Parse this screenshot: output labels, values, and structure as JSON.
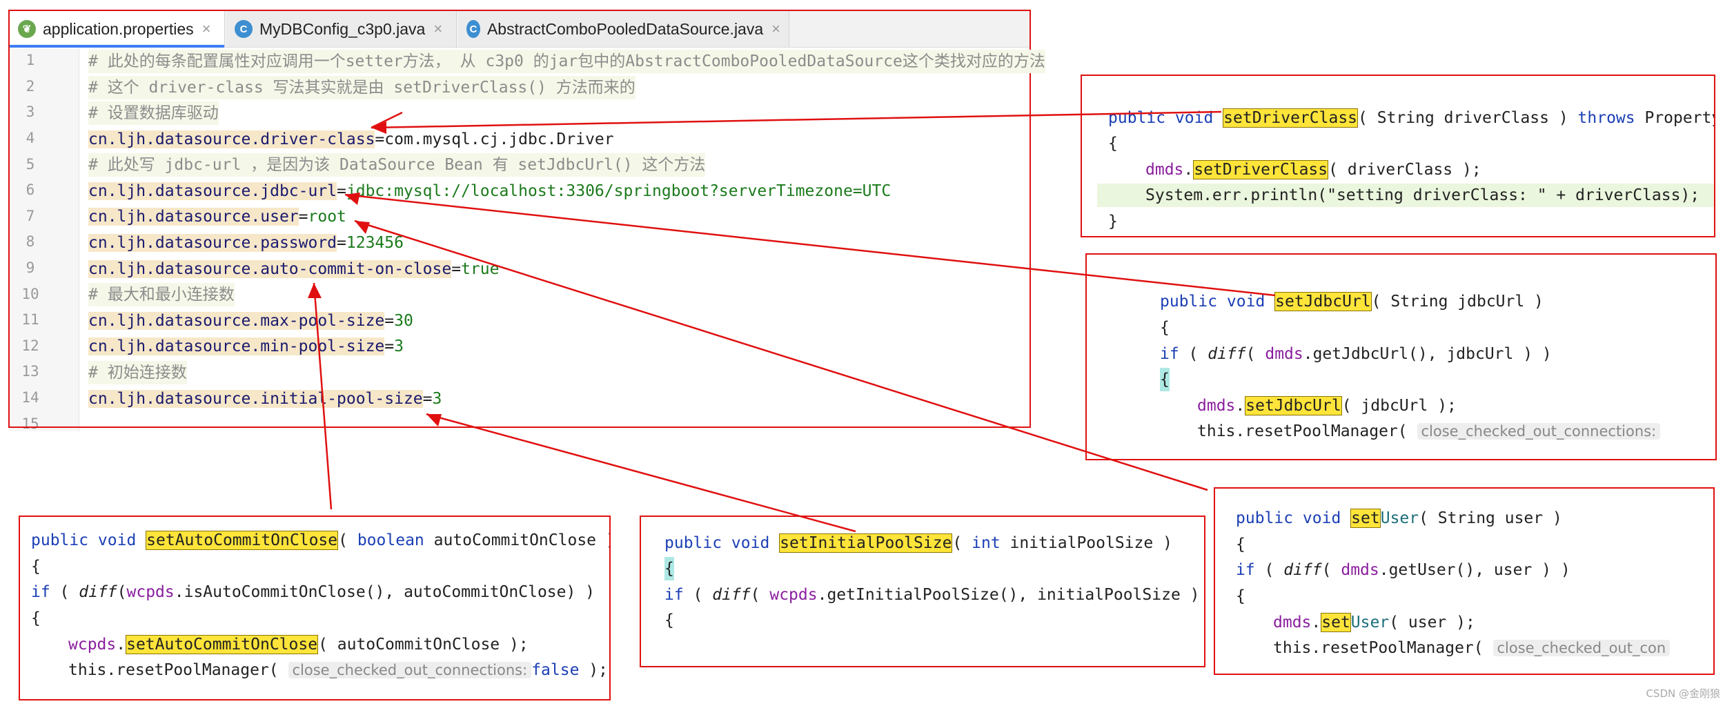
{
  "tabs": [
    {
      "label": "application.properties",
      "icon": "leaf-file-icon",
      "active": true
    },
    {
      "label": "MyDBConfig_c3p0.java",
      "icon": "class-file-icon",
      "active": false
    },
    {
      "label": "AbstractComboPooledDataSource.java",
      "icon": "class-file-icon",
      "active": false
    }
  ],
  "editor": {
    "line_numbers": [
      "1",
      "2",
      "3",
      "4",
      "5",
      "6",
      "7",
      "8",
      "9",
      "10",
      "11",
      "12",
      "13",
      "14",
      "15"
    ],
    "lines": {
      "l1": "# 此处的每条配置属性对应调用一个setter方法， 从 c3p0 的jar包中的AbstractComboPooledDataSource这个类找对应的方法",
      "l2": "# 这个 driver-class 写法其实就是由 setDriverClass() 方法而来的",
      "l3": "# 设置数据库驱动",
      "l4_key": "cn.ljh.datasource.driver-class",
      "l4_val": "com.mysql.cj.jdbc.Driver",
      "l5": "# 此处写 jdbc-url ，是因为该 DataSource Bean 有 setJdbcUrl() 这个方法",
      "l6_key": "cn.ljh.datasource.jdbc-url",
      "l6_val": "jdbc:mysql://localhost:3306/springboot?serverTimezone=UTC",
      "l7_key": "cn.ljh.datasource.user",
      "l7_val": "root",
      "l8_key": "cn.ljh.datasource.password",
      "l8_val": "123456",
      "l9_key": "cn.ljh.datasource.auto-commit-on-close",
      "l9_val": "true",
      "l10": "# 最大和最小连接数",
      "l11_key": "cn.ljh.datasource.max-pool-size",
      "l11_val": "30",
      "l12_key": "cn.ljh.datasource.min-pool-size",
      "l12_val": "3",
      "l13": "# 初始连接数",
      "l14_key": "cn.ljh.datasource.initial-pool-size",
      "l14_val": "3",
      "eq": "="
    }
  },
  "driver_box": {
    "kw1": "public void ",
    "m": "setDriverClass",
    "sig": "( String driverClass ) ",
    "kw2": "throws ",
    "tail": "PropertyVe",
    "open": "{",
    "f": "dmds",
    "dot": ".",
    "call": "setDriverClass",
    "args": "( driverClass );",
    "println": "System.err.println(\"setting driverClass: \" + driverClass);",
    "close": "}"
  },
  "jdbc_box": {
    "kw1": "public void ",
    "m": "setJdbcUrl",
    "sig": "( String jdbcUrl )",
    "open": "{",
    "if_kw": "if ",
    "p1": "( ",
    "diff": "diff",
    "p2": "( ",
    "f": "dmds",
    "get": ".getJdbcUrl(), jdbcUrl ) )",
    "open2": "{",
    "call": "setJdbcUrl",
    "args": "( jdbcUrl );",
    "reset": "this.resetPoolManager( ",
    "hint": "close_checked_out_connections:"
  },
  "user_box": {
    "kw1": "public void ",
    "m_hl": "set",
    "m_rest": "User",
    "sig": "( String user )",
    "open": "{",
    "if_kw": "if ",
    "p1": "( ",
    "diff": "diff",
    "p2": "( ",
    "f": "dmds",
    "get": ".getUser(), user ) )",
    "open2": "{",
    "call_hl": "set",
    "call_rest": "User",
    "args": "( user );",
    "reset": "this.resetPoolManager( ",
    "hint": "close_checked_out_con"
  },
  "auto_box": {
    "kw1": "public void ",
    "m": "setAutoCommitOnClose",
    "p": "( ",
    "kw2": "boolean ",
    "sig": "autoCommitOnClose )",
    "open": "{",
    "if_kw": "if ",
    "p1": "( ",
    "diff": "diff",
    "f": "wcpds",
    "get": "(wcpds.isAutoCommitOnClose(), autoCommitOnClose) )",
    "get_tail": ".isAutoCommitOnClose(), autoCommitOnClose) )",
    "open2": "{",
    "call": "setAutoCommitOnClose",
    "args": "( autoCommitOnClose );",
    "reset": "this.resetPoolManager( ",
    "hint": "close_checked_out_connections:",
    "false_kw": "false",
    "end": " );"
  },
  "init_box": {
    "kw1": "public void ",
    "m": "setInitialPoolSize",
    "p": "( ",
    "kw2": "int ",
    "sig": "initialPoolSize )",
    "open": "{",
    "if_kw": "if ",
    "p1": "( ",
    "diff": "diff",
    "p2": "( ",
    "f": "wcpds",
    "get": ".getInitialPoolSize(), initialPoolSize ) )",
    "open2": "{"
  },
  "watermark": "CSDN @金刚狼",
  "colors": {
    "arrow": "#e01010",
    "highlight": "#ffe43a",
    "keyword": "#1b3fb5",
    "field": "#8a1e9e",
    "value": "#1b7a1b"
  }
}
